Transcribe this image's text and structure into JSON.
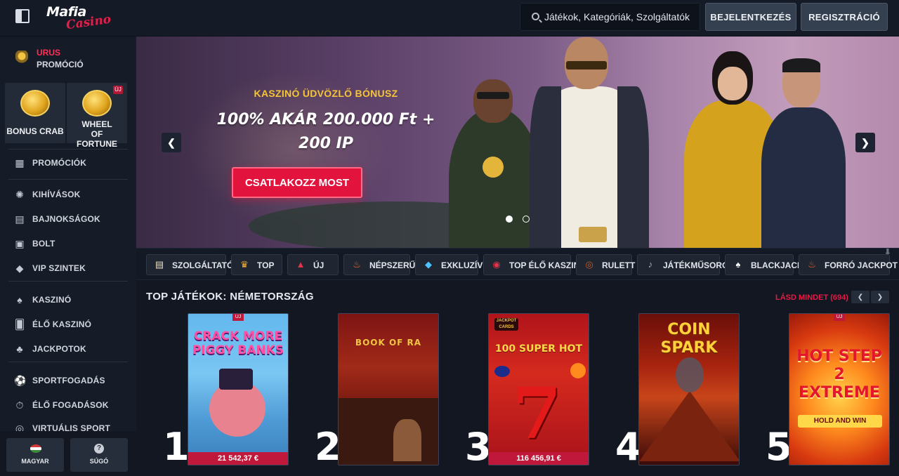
{
  "header": {
    "logo_word": "Mafia",
    "logo_script": "Casino",
    "search_placeholder": "Játékok, Kategóriák, Szolgáltatók",
    "login_label": "BEJELENTKEZÉS",
    "register_label": "REGISZTRÁCIÓ"
  },
  "sidebar": {
    "promo_title": "URUS",
    "promo_sub": "PROMÓCIÓ",
    "tiles": [
      {
        "label": "BONUS CRAB",
        "badge": ""
      },
      {
        "label": "WHEEL OF FORTUNE",
        "badge": "ÚJ"
      }
    ],
    "items": [
      {
        "label": "PROMÓCIÓK",
        "icon": "gift-icon"
      },
      {
        "label": "KIHÍVÁSOK",
        "icon": "target-icon"
      },
      {
        "label": "BAJNOKSÁGOK",
        "icon": "tournament-icon"
      },
      {
        "label": "BOLT",
        "icon": "shop-icon"
      },
      {
        "label": "VIP SZINTEK",
        "icon": "diamond-icon"
      },
      {
        "label": "KASZINÓ",
        "icon": "spade-icon"
      },
      {
        "label": "ÉLŐ KASZINÓ",
        "icon": "cards-icon"
      },
      {
        "label": "JACKPOTOK",
        "icon": "clover-icon"
      },
      {
        "label": "SPORTFOGADÁS",
        "icon": "ball-icon"
      },
      {
        "label": "ÉLŐ FOGADÁSOK",
        "icon": "live-bet-icon"
      },
      {
        "label": "VIRTUÁLIS SPORT",
        "icon": "virtual-icon"
      }
    ],
    "language_label": "MAGYAR",
    "help_label": "SÚGÓ"
  },
  "hero": {
    "subtitle": "KASZINÓ ÜDVÖZLŐ BÓNUSZ",
    "title_line1": "100% AKÁR 200.000 Ft +",
    "title_line2": "200 IP",
    "cta_label": "CSATLAKOZZ MOST",
    "slides_total": 2,
    "active_slide": 1
  },
  "categories": [
    {
      "label": "SZOLGÁLTATÓK",
      "icon": "providers-icon",
      "color": "#e8dcc0"
    },
    {
      "label": "TOP",
      "icon": "crown-icon",
      "color": "#f2b233"
    },
    {
      "label": "ÚJ",
      "icon": "new-icon",
      "color": "#e2334b"
    },
    {
      "label": "NÉPSZERŰ",
      "icon": "fire-icon",
      "color": "#ff6a1f"
    },
    {
      "label": "EXKLUZÍV",
      "icon": "gem-icon",
      "color": "#4cc3ff"
    },
    {
      "label": "TOP ÉLŐ KASZINÓ",
      "icon": "chip-icon",
      "color": "#e2334b"
    },
    {
      "label": "RULETT",
      "icon": "roulette-icon",
      "color": "#c65a2a"
    },
    {
      "label": "JÁTÉKMŰSOROK",
      "icon": "microphone-icon",
      "color": "#aab2c0"
    },
    {
      "label": "BLACKJACK",
      "icon": "blackjack-icon",
      "color": "#ffffff"
    },
    {
      "label": "FORRÓ JACKPOT",
      "icon": "hot-jackpot-icon",
      "color": "#ff5a1f"
    }
  ],
  "top_games": {
    "title": "TOP JÁTÉKOK: NÉMETORSZÁG",
    "see_all": "LÁSD MINDET (694)",
    "games": [
      {
        "rank": "1",
        "name": "CRACK MORE PIGGY BANKS",
        "price": "21 542,37 €",
        "badge": "ÚJ"
      },
      {
        "rank": "2",
        "name": "BOOK OF RA",
        "price": "",
        "badge": ""
      },
      {
        "rank": "3",
        "name": "100 SUPER HOT",
        "price": "116 456,91 €",
        "badge": ""
      },
      {
        "rank": "4",
        "name": "COIN SPARK",
        "price": "",
        "badge": ""
      },
      {
        "rank": "5",
        "name": "HOT STEP 2 EXTREME",
        "price": "",
        "badge": "ÚJ"
      }
    ],
    "game5_sub": "HOLD AND WIN",
    "game3_logo": "JACKPOT CARDS"
  },
  "colors": {
    "accent": "#e2143d",
    "gold": "#f5c437",
    "bg": "#121722"
  }
}
